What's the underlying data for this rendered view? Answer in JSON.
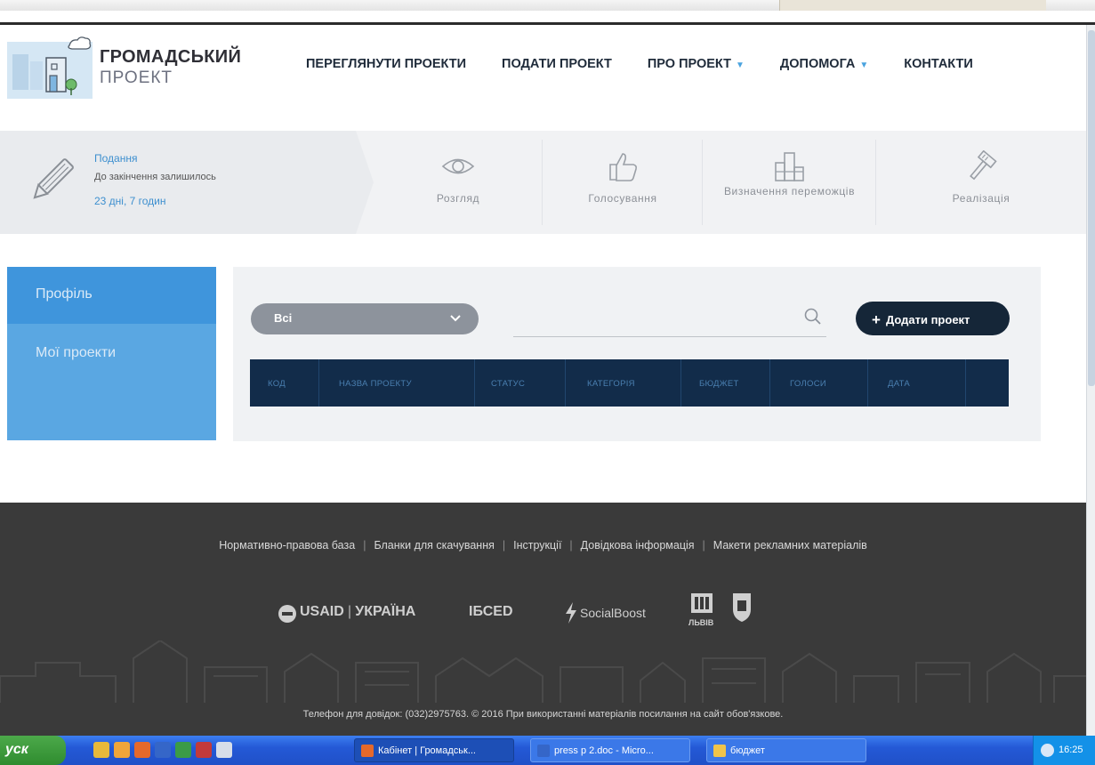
{
  "header": {
    "brand_title": "ГРОМАДСЬКИЙ",
    "brand_sub": "ПРОЕКТ",
    "nav": [
      {
        "label": "ПЕРЕГЛЯНУТИ ПРОЕКТИ"
      },
      {
        "label": "ПОДАТИ ПРОЕКТ"
      },
      {
        "label": "ПРО ПРОЕКТ",
        "dropdown": true
      },
      {
        "label": "ДОПОМОГА",
        "dropdown": true
      },
      {
        "label": "КОНТАКТИ"
      }
    ],
    "accent_color": "#4aa3df"
  },
  "stages": {
    "current": {
      "name": "Подання",
      "remaining_label": "До закінчення залишилось",
      "time": "23 дні, 7 годин",
      "icon": "pencil-icon"
    },
    "steps": [
      {
        "label": "Розгляд",
        "icon": "eye-icon"
      },
      {
        "label": "Голосування",
        "icon": "thumbs-up-icon"
      },
      {
        "label": "Визначення переможців",
        "icon": "podium-icon"
      },
      {
        "label": "Реалізація",
        "icon": "hammer-icon"
      }
    ]
  },
  "sidebar": {
    "items": [
      {
        "label": "Профіль",
        "active": true
      },
      {
        "label": "Мої проекти"
      }
    ],
    "color": "#5aa7e2"
  },
  "filters": {
    "status_select": "Всі",
    "search_placeholder": "",
    "add_button": "Додати проект"
  },
  "table": {
    "columns": [
      "КОД",
      "НАЗВА ПРОЕКТУ",
      "СТАТУС",
      "КАТЕГОРІЯ",
      "БЮДЖЕТ",
      "ГОЛОСИ",
      "ДАТА"
    ],
    "rows": [],
    "header_color": "#122c4a"
  },
  "footer": {
    "links": [
      "Нормативно-правова база",
      "Бланки для скачування",
      "Інструкції",
      "Довідкова інформація",
      "Макети рекламних матеріалів"
    ],
    "partners": {
      "usaid": "USAID",
      "ukraine": "УКРАЇНА",
      "isced": "ІБСЕD",
      "socialboost": "SocialBoost",
      "lviv": "ЛЬВІВ"
    },
    "copyright": "Телефон для довідок: (032)2975763. © 2016 При використанні матеріалів посилання на сайт обов'язкове."
  },
  "taskbar": {
    "start_label": "уск",
    "tasks": [
      {
        "label": "Кабінет | Громадськ...",
        "active": true
      },
      {
        "label": "press p 2.doc - Micro...",
        "active": false
      },
      {
        "label": "бюджет",
        "active": false
      }
    ],
    "clock": "16:25"
  }
}
